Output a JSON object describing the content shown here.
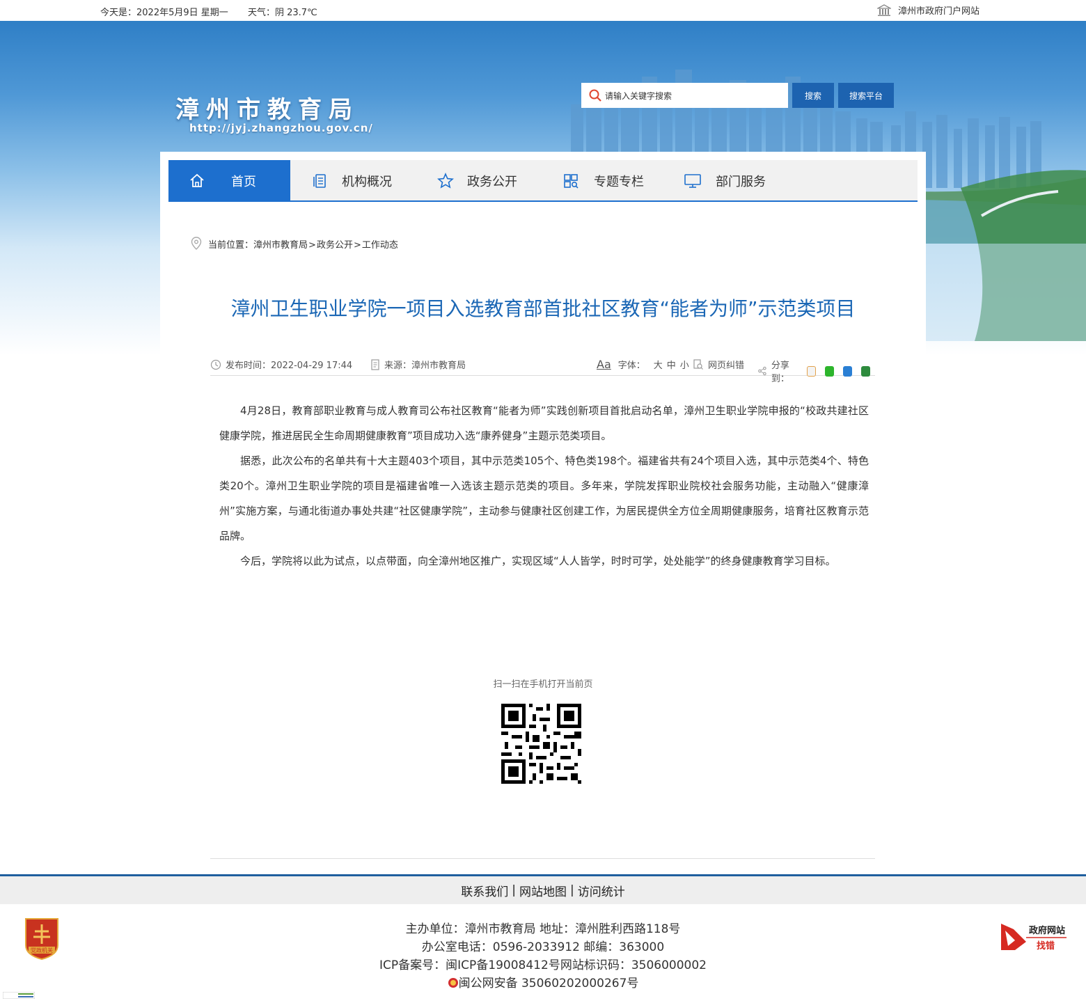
{
  "topbar": {
    "date": "今天是：2022年5月9日 星期一",
    "weather": "天气：阴 23.7℃",
    "portal_link": "漳州市政府门户网站"
  },
  "header": {
    "title": "漳州市教育局",
    "url": "http://jyj.zhangzhou.gov.cn/",
    "search_placeholder": "请输入关键字搜索",
    "search_button": "搜索",
    "platform_button": "搜索平台"
  },
  "nav": [
    {
      "label": "首页",
      "icon": "home-icon",
      "active": true
    },
    {
      "label": "机构概况",
      "icon": "document-icon",
      "active": false
    },
    {
      "label": "政务公开",
      "icon": "star-icon",
      "active": false
    },
    {
      "label": "专题专栏",
      "icon": "grid-icon",
      "active": false
    },
    {
      "label": "部门服务",
      "icon": "monitor-icon",
      "active": false
    }
  ],
  "breadcrumb": {
    "prefix": "当前位置：",
    "items": [
      "漳州市教育局",
      "政务公开",
      "工作动态"
    ],
    "separator": ">"
  },
  "article": {
    "title": "漳州卫生职业学院一项目入选教育部首批社区教育“能者为师”示范类项目",
    "publish_time": "发布时间：2022-04-29 17:44",
    "source": "来源：漳州市教育局",
    "font_label": "字体：",
    "font_sizes": [
      "大",
      "中",
      "小"
    ],
    "font_icon_text": "Aa",
    "correction": "网页纠错",
    "share_label": "分享到：",
    "paragraphs": [
      "4月28日，教育部职业教育与成人教育司公布社区教育“能者为师”实践创新项目首批启动名单，漳州卫生职业学院申报的“校政共建社区健康学院，推进居民全生命周期健康教育”项目成功入选“康养健身”主题示范类项目。",
      "据悉，此次公布的名单共有十大主题403个项目，其中示范类105个、特色类198个。福建省共有24个项目入选，其中示范类4个、特色类20个。漳州卫生职业学院的项目是福建省唯一入选该主题示范类的项目。多年来，学院发挥职业院校社会服务功能，主动融入“健康漳州”实施方案，与通北街道办事处共建“社区健康学院”，主动参与健康社区创建工作，为居民提供全方位全周期健康服务，培育社区教育示范品牌。",
      "今后，学院将以此为试点，以点带面，向全漳州地区推广，实现区域“人人皆学，时时可学，处处能学”的终身健康教育学习目标。"
    ],
    "qr_label": "扫一扫在手机打开当前页"
  },
  "footer": {
    "links": [
      "联系我们",
      "网站地图",
      "访问统计"
    ],
    "host": "主办单位：漳州市教育局 地址：漳州胜利西路118号",
    "phone": "办公室电话：0596-2033912 邮编：363000",
    "icp": "ICP备案号：闽ICP备19008412号网站标识码：3506000002",
    "police": "闽公网安备 35060202000267号",
    "party_badge": "党政机关",
    "gov_site_title": "政府网站",
    "gov_site_sub": "找错"
  },
  "colors": {
    "primary": "#1d6fce",
    "title_blue": "#1b67b5",
    "footer_border": "#1f5f9e"
  }
}
